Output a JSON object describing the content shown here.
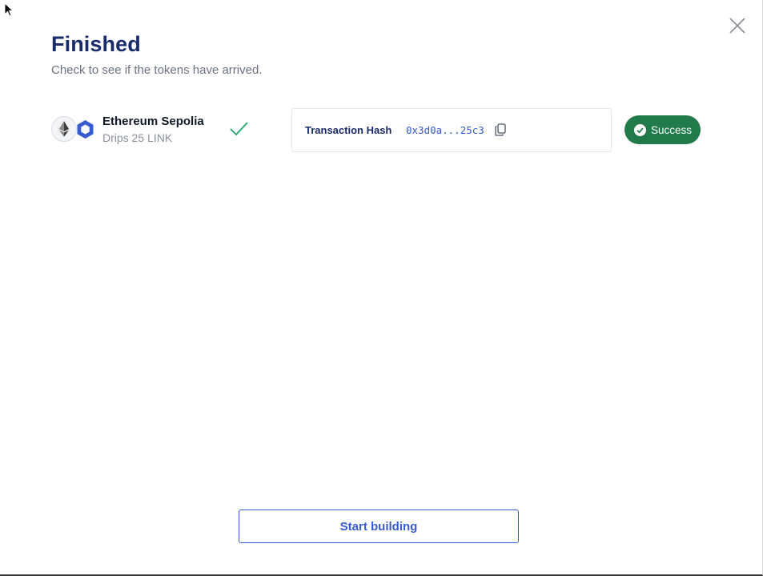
{
  "modal": {
    "title": "Finished",
    "subtitle": "Check to see if the tokens have arrived."
  },
  "network": {
    "name": "Ethereum Sepolia",
    "drip": "Drips 25 LINK",
    "logos": [
      "ethereum-icon",
      "chainlink-icon"
    ],
    "status_icon": "checkmark-icon"
  },
  "transaction": {
    "label": "Transaction Hash",
    "hash": "0x3d0a...25c3",
    "copy_icon": "copy-icon"
  },
  "status_badge": {
    "label": "Success",
    "icon": "check-circle-icon",
    "color": "#217a4a"
  },
  "actions": {
    "start_building": "Start building"
  },
  "colors": {
    "title": "#1a2b6b",
    "accent": "#375bd2",
    "success_check": "#21a366"
  }
}
